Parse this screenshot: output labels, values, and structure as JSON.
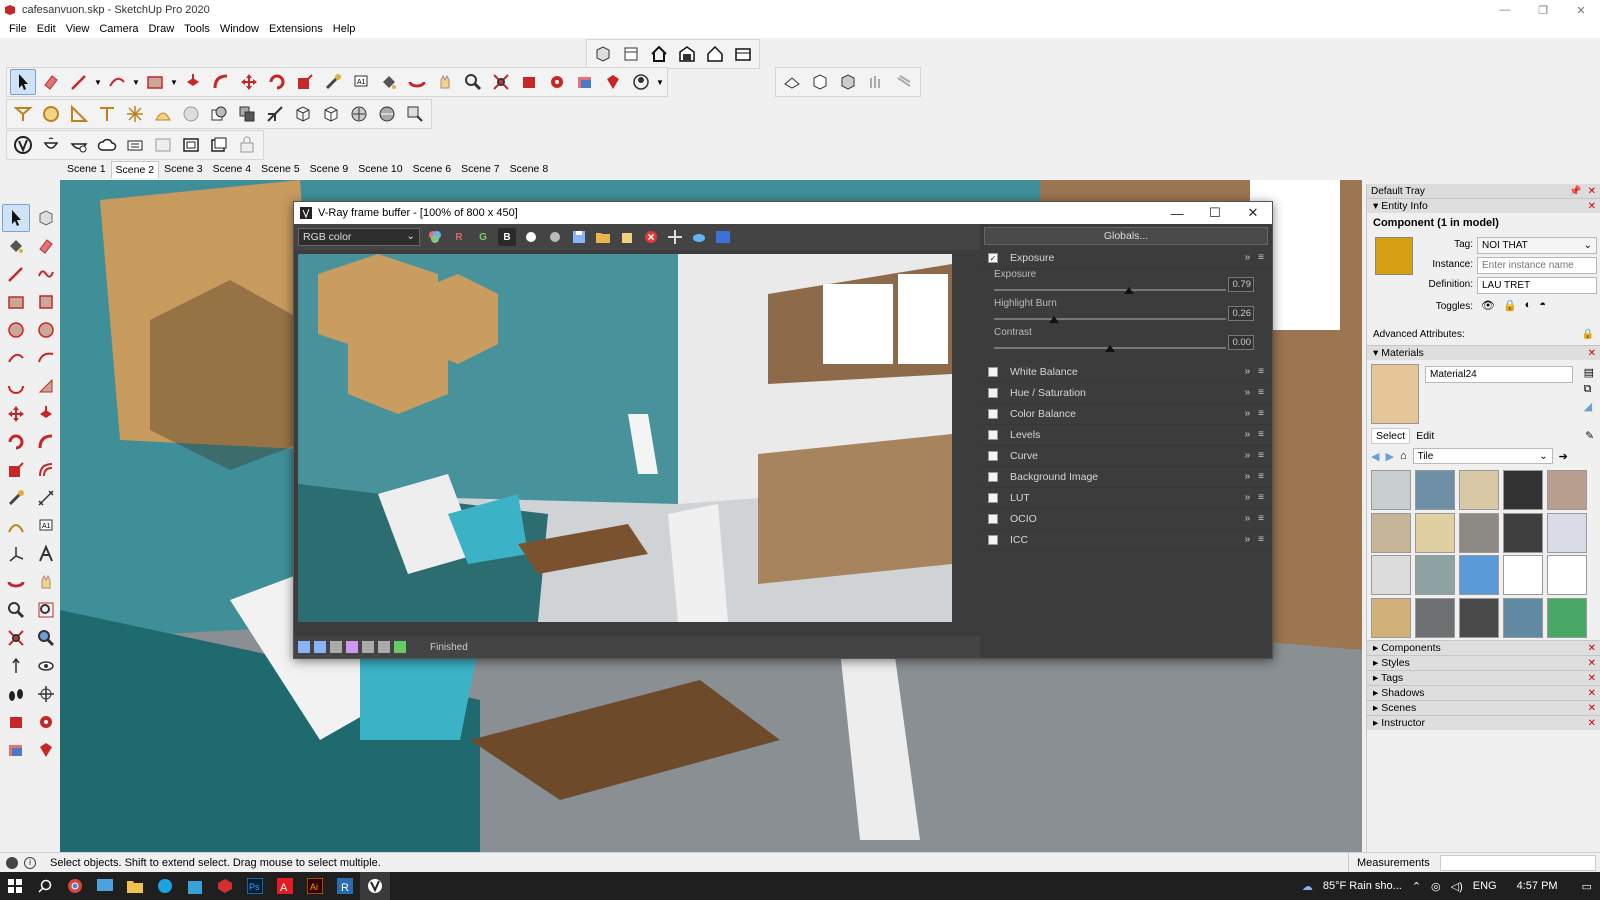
{
  "window": {
    "title": "cafesanvuon.skp - SketchUp Pro 2020"
  },
  "menu": [
    "File",
    "Edit",
    "View",
    "Camera",
    "Draw",
    "Tools",
    "Window",
    "Extensions",
    "Help"
  ],
  "scenes": {
    "tabs": [
      "Scene 1",
      "Scene 2",
      "Scene 3",
      "Scene 4",
      "Scene 5",
      "Scene 9",
      "Scene 10",
      "Scene 6",
      "Scene 7",
      "Scene 8"
    ],
    "active": "Scene 2"
  },
  "vray": {
    "title": "V-Ray frame buffer - [100% of 800 x 450]",
    "channel": "RGB color",
    "r": "R",
    "g": "G",
    "b": "B",
    "globals": "Globals...",
    "status": "Finished",
    "exposure_layer": "Exposure",
    "sliders": [
      {
        "label": "Exposure",
        "value": "0.79",
        "pos": 0.58
      },
      {
        "label": "Highlight Burn",
        "value": "0.26",
        "pos": 0.26
      },
      {
        "label": "Contrast",
        "value": "0.00",
        "pos": 0.5
      }
    ],
    "layers": [
      "White Balance",
      "Hue / Saturation",
      "Color Balance",
      "Levels",
      "Curve",
      "Background Image",
      "LUT",
      "OCIO",
      "ICC"
    ]
  },
  "tray": {
    "title": "Default Tray",
    "entity_info": "Entity Info",
    "component": "Component (1 in model)",
    "tag_label": "Tag:",
    "tag_value": "NOI THAT",
    "instance_label": "Instance:",
    "instance_placeholder": "Enter instance name",
    "definition_label": "Definition:",
    "definition_value": "LAU TRET",
    "toggles_label": "Toggles:",
    "advanced": "Advanced Attributes:",
    "materials": "Materials",
    "material_name": "Material24",
    "select_tab": "Select",
    "edit_tab": "Edit",
    "library": "Tile",
    "collapsed": [
      "Components",
      "Styles",
      "Tags",
      "Shadows",
      "Scenes",
      "Instructor"
    ],
    "swatch_colors": [
      "#c9cfd1",
      "#6f8fa6",
      "#d8c8a6",
      "#333333",
      "#b79e8e",
      "#c7b59a",
      "#e0cfa3",
      "#8d8985",
      "#3f3f3f",
      "#d9dce6",
      "#dcdcdc",
      "#8ea2a4",
      "#5a9ad8",
      "#ffffff",
      "#ffffff",
      "#d1b179",
      "#6d7070",
      "#4a4a4a",
      "#5f8aa2",
      "#49a865"
    ]
  },
  "status": {
    "hint": "Select objects. Shift to extend select. Drag mouse to select multiple.",
    "measurements": "Measurements"
  },
  "taskbar": {
    "weather": "85°F  Rain sho...",
    "lang": "ENG",
    "time": "4:57 PM"
  },
  "colors": {
    "accent": "#d32f2f",
    "sketchup_red": "#c62828",
    "vray_bg": "#3c3c3c"
  }
}
